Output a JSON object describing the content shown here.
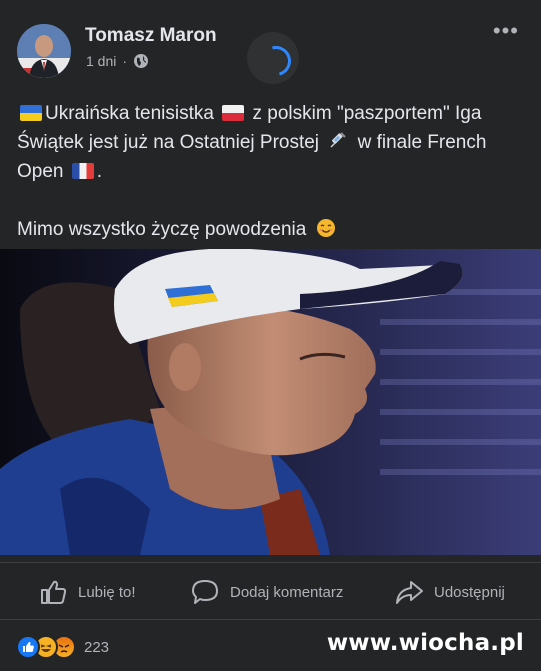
{
  "post": {
    "author": "Tomasz Maron",
    "time": "1 dni",
    "time_separator": "·",
    "more_label": "•••",
    "line1_a": "Ukraińska tenisistka",
    "line1_b": "z polskim \"paszportem\" Iga Świątek jest już na Ostatniej Prostej",
    "line1_c": "w finale French Open",
    "line1_d": ".",
    "line2": "Mimo wszystko życzę powodzenia"
  },
  "actions": {
    "like": "Lubię to!",
    "comment": "Dodaj komentarz",
    "share": "Udostępnij"
  },
  "reactions": {
    "count": "223",
    "types": [
      "like",
      "haha",
      "angry"
    ]
  },
  "watermark": "www.wiocha.pl",
  "colors": {
    "background": "#242526",
    "text": "#e4e6eb",
    "muted": "#b0b3b8",
    "accent": "#2d88ff"
  },
  "icons": [
    "globe-icon",
    "more-icon",
    "loading-spinner-icon",
    "ukraine-flag-icon",
    "poland-flag-icon",
    "syringe-icon",
    "france-flag-icon",
    "smile-icon",
    "like-icon",
    "comment-icon",
    "share-icon"
  ]
}
